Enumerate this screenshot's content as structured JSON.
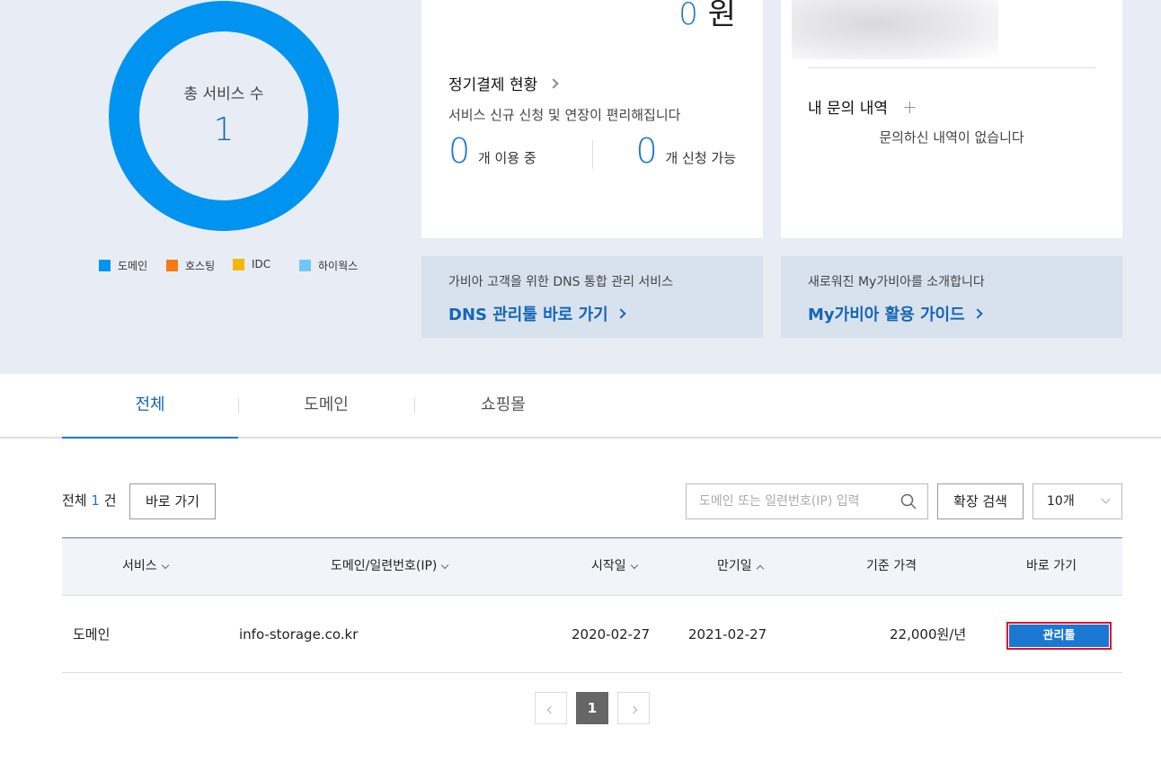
{
  "summary": {
    "donut_label": "총 서비스 수",
    "donut_count": "1",
    "legend": [
      {
        "label": "도메인",
        "color": "#0094f0"
      },
      {
        "label": "호스팅",
        "color": "#f57a10"
      },
      {
        "label": "IDC",
        "color": "#f5b800"
      },
      {
        "label": "하이웍스",
        "color": "#6ec8f7"
      }
    ]
  },
  "billing": {
    "amount": "0",
    "currency": "원",
    "title": "정기결제 현황",
    "description": "서비스 신규 신청 및 연장이 편리해집니다",
    "in_use_count": "0",
    "in_use_label": "개 이용 중",
    "available_count": "0",
    "available_label": "개 신청 가능"
  },
  "inquiry": {
    "title": "내 문의 내역",
    "plus": "+",
    "empty_text": "문의하신 내역이 없습니다"
  },
  "banners": {
    "dns_desc": "가비아 고객을 위한 DNS 통합 관리 서비스",
    "dns_link": "DNS 관리툴 바로 가기",
    "my_desc": "새로워진 My가비아를 소개합니다",
    "my_link": "My가비아 활용 가이드"
  },
  "tabs": [
    "전체",
    "도메인",
    "쇼핑몰"
  ],
  "toolbar": {
    "total_prefix": "전체",
    "total_count": "1",
    "total_suffix": "건",
    "goto_label": "바로 가기",
    "search_placeholder": "도메인 또는 일련번호(IP) 입력",
    "adv_search_label": "확장 검색",
    "page_size": "10개"
  },
  "table": {
    "headers": {
      "service": "서비스",
      "domain": "도메인/일련번호(IP)",
      "start": "시작일",
      "expire": "만기일",
      "price": "기준 가격",
      "goto": "바로 가기"
    },
    "rows": [
      {
        "service": "도메인",
        "domain": "info-storage.co.kr",
        "start": "2020-02-27",
        "expire": "2021-02-27",
        "price": "22,000원/년",
        "action": "관리툴"
      }
    ]
  },
  "pagination": {
    "current": "1"
  }
}
